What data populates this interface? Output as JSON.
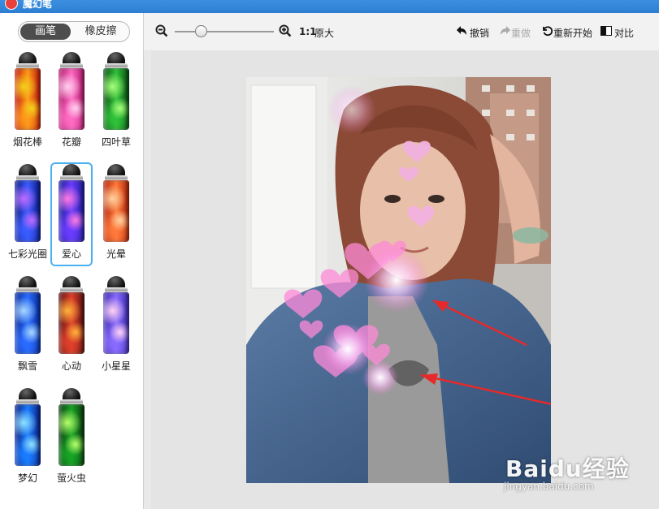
{
  "window": {
    "title": "魔幻笔"
  },
  "mode_tabs": [
    {
      "label": "画笔",
      "active": true
    },
    {
      "label": "橡皮擦",
      "active": false
    }
  ],
  "brushes": [
    {
      "label": "烟花棒",
      "colors": [
        "#c0180c",
        "#ff9a1a",
        "#f2d01a"
      ]
    },
    {
      "label": "花瓣",
      "colors": [
        "#b0196b",
        "#ff6bc4",
        "#ffd0ee"
      ]
    },
    {
      "label": "四叶草",
      "colors": [
        "#0a4d12",
        "#2fc23a",
        "#a7ff7a"
      ]
    },
    {
      "label": "七彩光圈",
      "colors": [
        "#0c1a8a",
        "#3a5cff",
        "#c06bff"
      ]
    },
    {
      "label": "爱心",
      "colors": [
        "#1c1e9b",
        "#6a3cff",
        "#ff7ae0"
      ],
      "selected": true
    },
    {
      "label": "光晕",
      "colors": [
        "#b3240b",
        "#ff7a3a",
        "#ffd3a0"
      ]
    },
    {
      "label": "飘雪",
      "colors": [
        "#082c9e",
        "#2a6cff",
        "#a8d8ff"
      ]
    },
    {
      "label": "心动",
      "colors": [
        "#5a1212",
        "#e0402b",
        "#ffb23a"
      ]
    },
    {
      "label": "小星星",
      "colors": [
        "#3b2ab0",
        "#8a6cff",
        "#ffd2f2"
      ]
    },
    {
      "label": "梦幻",
      "colors": [
        "#0a1f86",
        "#1a7dff",
        "#8fe2ff"
      ]
    },
    {
      "label": "萤火虫",
      "colors": [
        "#0b3a10",
        "#17a425",
        "#b6ff6a"
      ]
    }
  ],
  "toolbar": {
    "zoom_level": 0.25,
    "zoom_label": "1:1",
    "original_size_label": "原大",
    "undo_label": "撤销",
    "redo_label": "重做",
    "restart_label": "重新开始",
    "compare_label": "对比"
  },
  "watermark": {
    "logo": "Baidu经验",
    "url": "jingyan.baidu.com"
  }
}
